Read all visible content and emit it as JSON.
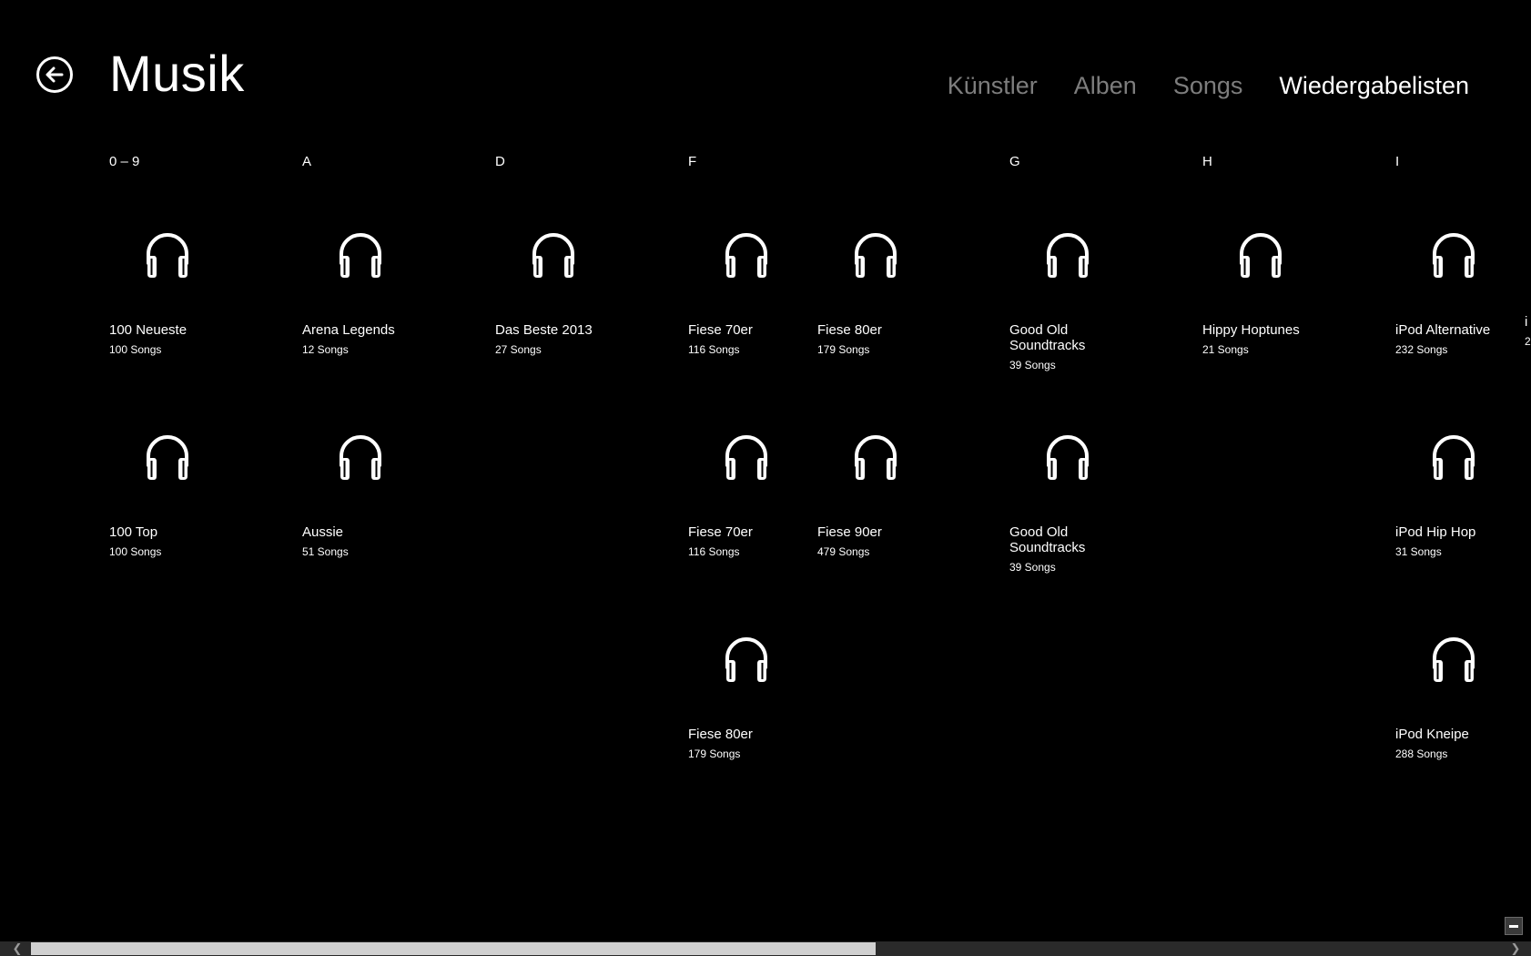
{
  "header": {
    "title": "Musik",
    "tabs": [
      {
        "label": "Künstler"
      },
      {
        "label": "Alben"
      },
      {
        "label": "Songs"
      },
      {
        "label": "Wiedergabelisten",
        "active": true
      }
    ]
  },
  "groups": [
    {
      "letter": "0 – 9",
      "items": [
        {
          "title": "100 Neueste",
          "count": "100 Songs"
        },
        {
          "title": "100 Top",
          "count": "100 Songs"
        }
      ]
    },
    {
      "letter": "A",
      "items": [
        {
          "title": "Arena Legends",
          "count": "12 Songs"
        },
        {
          "title": "Aussie",
          "count": "51 Songs"
        }
      ]
    },
    {
      "letter": "D",
      "items": [
        {
          "title": "Das Beste 2013",
          "count": "27 Songs"
        }
      ]
    },
    {
      "letter": "F",
      "items": [
        {
          "title": "Fiese 70er",
          "count": "116 Songs"
        },
        {
          "title": "Fiese 70er",
          "count": "116 Songs"
        },
        {
          "title": "Fiese 80er",
          "count": "179 Songs"
        },
        {
          "title": "Fiese 80er",
          "count": "179 Songs"
        },
        {
          "title": "Fiese 90er",
          "count": "479 Songs"
        }
      ]
    },
    {
      "letter": "G",
      "items": [
        {
          "title": "Good Old Soundtracks",
          "count": "39 Songs"
        },
        {
          "title": "Good Old Soundtracks",
          "count": "39 Songs"
        }
      ]
    },
    {
      "letter": "H",
      "items": [
        {
          "title": "Hippy Hoptunes",
          "count": "21 Songs"
        }
      ]
    },
    {
      "letter": "I",
      "items": [
        {
          "title": "iPod Alternative",
          "count": "232 Songs"
        },
        {
          "title": "iPod Hip Hop",
          "count": "31 Songs"
        },
        {
          "title": "iPod Kneipe",
          "count": "288 Songs"
        }
      ]
    }
  ],
  "clipped_item": {
    "title": "i",
    "count": "2"
  },
  "icons": {
    "tile": "headphones-icon",
    "back": "back-arrow-icon",
    "zoom": "minus-icon"
  },
  "colors": {
    "background": "#000000",
    "text": "#ffffff",
    "inactive_tab": "#7d7d7d"
  }
}
